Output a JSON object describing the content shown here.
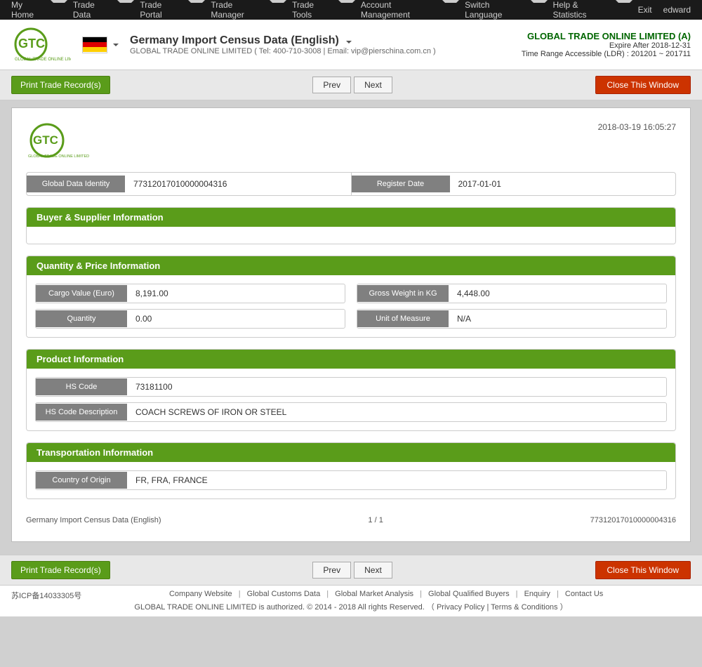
{
  "topNav": {
    "items": [
      {
        "label": "My Home",
        "id": "my-home"
      },
      {
        "label": "Trade Data",
        "id": "trade-data"
      },
      {
        "label": "Trade Portal",
        "id": "trade-portal"
      },
      {
        "label": "Trade Manager",
        "id": "trade-manager"
      },
      {
        "label": "Trade Tools",
        "id": "trade-tools"
      },
      {
        "label": "Account Management",
        "id": "account-management"
      },
      {
        "label": "Switch Language",
        "id": "switch-language"
      },
      {
        "label": "Help & Statistics",
        "id": "help-statistics"
      }
    ],
    "exit": "Exit",
    "user": "edward"
  },
  "header": {
    "title": "Germany Import Census Data (English)",
    "subtitle": "GLOBAL TRADE ONLINE LIMITED ( Tel: 400-710-3008  |  Email: vip@pierschina.com.cn )",
    "company": "GLOBAL TRADE ONLINE LIMITED (A)",
    "expire": "Expire After 2018-12-31",
    "timeRange": "Time Range Accessible (LDR) : 201201 ~ 201711",
    "flagAlt": "Germany flag"
  },
  "toolbar": {
    "printLabel": "Print Trade Record(s)",
    "prevLabel": "Prev",
    "nextLabel": "Next",
    "closeLabel": "Close This Window"
  },
  "record": {
    "timestamp": "2018-03-19 16:05:27",
    "identity": {
      "globalDataLabel": "Global Data Identity",
      "globalDataValue": "77312017010000004316",
      "registerDateLabel": "Register Date",
      "registerDateValue": "2017-01-01"
    },
    "sections": {
      "buyerSupplier": {
        "title": "Buyer & Supplier Information",
        "fields": []
      },
      "quantityPrice": {
        "title": "Quantity & Price Information",
        "fields": [
          {
            "label": "Cargo Value (Euro)",
            "value": "8,191.00"
          },
          {
            "label": "Gross Weight in KG",
            "value": "4,448.00"
          },
          {
            "label": "Quantity",
            "value": "0.00"
          },
          {
            "label": "Unit of Measure",
            "value": "N/A"
          }
        ]
      },
      "productInfo": {
        "title": "Product Information",
        "fields": [
          {
            "label": "HS Code",
            "value": "73181100"
          },
          {
            "label": "HS Code Description",
            "value": "COACH SCREWS OF IRON OR STEEL"
          }
        ]
      },
      "transportation": {
        "title": "Transportation Information",
        "fields": [
          {
            "label": "Country of Origin",
            "value": "FR, FRA, FRANCE"
          }
        ]
      }
    },
    "footer": {
      "title": "Germany Import Census Data (English)",
      "page": "1 / 1",
      "id": "77312017010000004316"
    }
  },
  "footerLinks": [
    {
      "label": "Company Website"
    },
    {
      "label": "Global Customs Data"
    },
    {
      "label": "Global Market Analysis"
    },
    {
      "label": "Global Qualified Buyers"
    },
    {
      "label": "Enquiry"
    },
    {
      "label": "Contact Us"
    }
  ],
  "copyright": "GLOBAL TRADE ONLINE LIMITED is authorized. © 2014 - 2018 All rights Reserved.  （ Privacy Policy  |  Terms & Conditions ）",
  "icp": "苏ICP备14033305号"
}
